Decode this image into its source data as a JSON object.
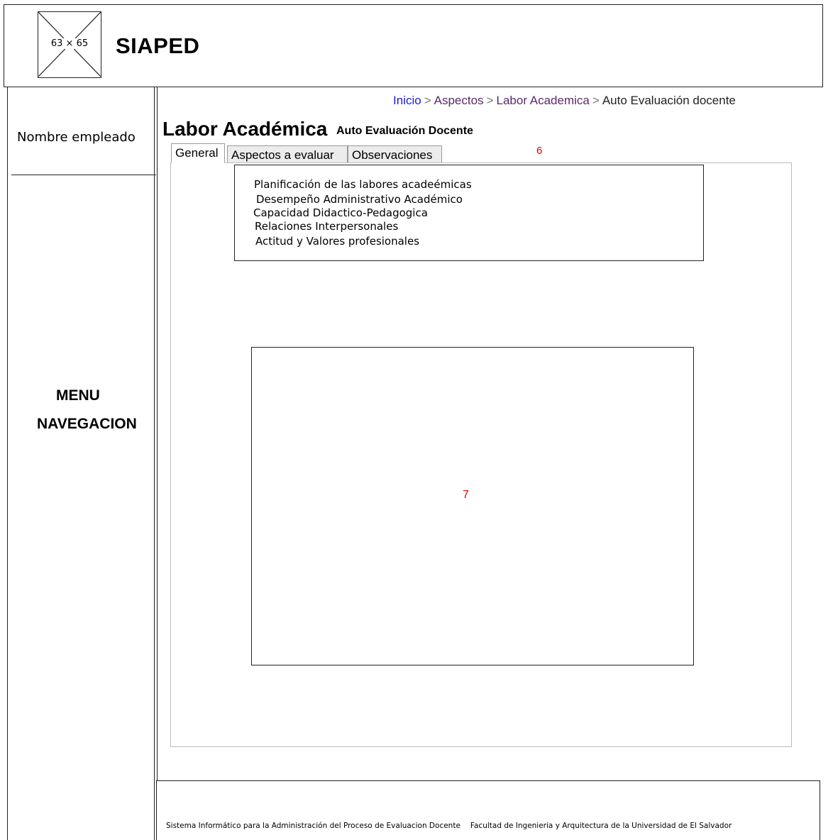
{
  "header": {
    "logo_placeholder": "63 × 65",
    "app_title": "SIAPED"
  },
  "sidebar": {
    "user_name": "Nombre empleado",
    "menu_line1": "MENU",
    "menu_line2": "NAVEGACION"
  },
  "breadcrumb": {
    "items": [
      "Inicio",
      "Aspectos",
      "Labor Academica",
      "Auto Evaluación docente"
    ],
    "separator": ">"
  },
  "page": {
    "title": "Labor Académica",
    "subtitle": "Auto Evaluación Docente"
  },
  "tabs": [
    {
      "label": "General",
      "active": true
    },
    {
      "label": "Aspectos a evaluar",
      "active": false
    },
    {
      "label": "Observaciones",
      "active": false
    }
  ],
  "annotations": {
    "marker_6": "6",
    "marker_7": "7"
  },
  "aspects": [
    "Planificación de las labores acadeémicas",
    "Desempeño Administrativo Académico",
    "Capacidad  Didactico-Pedagogica",
    "Relaciones Interpersonales",
    "Actitud y Valores profesionales"
  ],
  "footer": {
    "system_name": "Sistema Informático para la Administración del Proceso de Evaluacion Docente",
    "faculty": "Facultad de Ingenieria y Arquitectura de la Universidad de El Salvador"
  },
  "colors": {
    "annotation_red": "#e00000",
    "link_blue": "#1a1ae6",
    "link_visited": "#5a2a6a"
  }
}
